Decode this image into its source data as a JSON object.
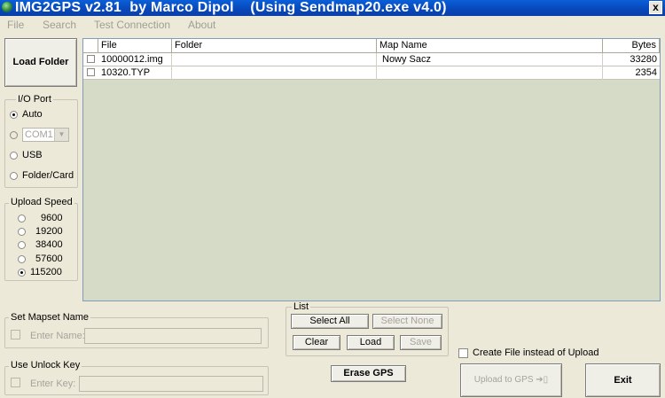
{
  "window": {
    "title": "IMG2GPS v2.81  by Marco Dipol    (Using Sendmap20.exe v4.0)",
    "close_glyph": "x"
  },
  "menu": [
    {
      "label": "File",
      "mnemonic": "F"
    },
    {
      "label": "Search",
      "mnemonic": "S"
    },
    {
      "label": "Test Connection",
      "mnemonic": "T"
    },
    {
      "label": "About",
      "mnemonic": "A"
    }
  ],
  "load_folder_label": "Load Folder",
  "io_port": {
    "title": "I/O Port",
    "options": [
      "Auto",
      "COM1",
      "USB",
      "Folder/Card"
    ],
    "selected": "Auto",
    "com_value": "COM1"
  },
  "upload_speed": {
    "title": "Upload Speed",
    "options": [
      "9600",
      "19200",
      "38400",
      "57600",
      "115200"
    ],
    "selected": "115200"
  },
  "file_table": {
    "columns": [
      "File",
      "Folder",
      "Map Name",
      "Bytes"
    ],
    "rows": [
      {
        "file": "10000012.img",
        "folder": "",
        "map_name": "Nowy Sacz",
        "bytes": "33280"
      },
      {
        "file": "10320.TYP",
        "folder": "",
        "map_name": "",
        "bytes": "2354"
      }
    ]
  },
  "mapset": {
    "title": "Set Mapset Name",
    "label": "Enter Name:",
    "value": ""
  },
  "unlock": {
    "title": "Use Unlock Key",
    "label": "Enter Key:",
    "value": ""
  },
  "list_group": {
    "title": "List",
    "select_all": "Select All",
    "select_none": "Select None",
    "clear": "Clear",
    "load": "Load",
    "save": "Save"
  },
  "erase_gps_label": "Erase GPS",
  "create_file_label": "Create File instead of Upload",
  "upload_label": "Upload to GPS",
  "exit_label": "Exit",
  "colors": {
    "titlebar": "#0a5fd8",
    "window_bg": "#ece9d8",
    "list_bg": "#d6dbc8"
  }
}
